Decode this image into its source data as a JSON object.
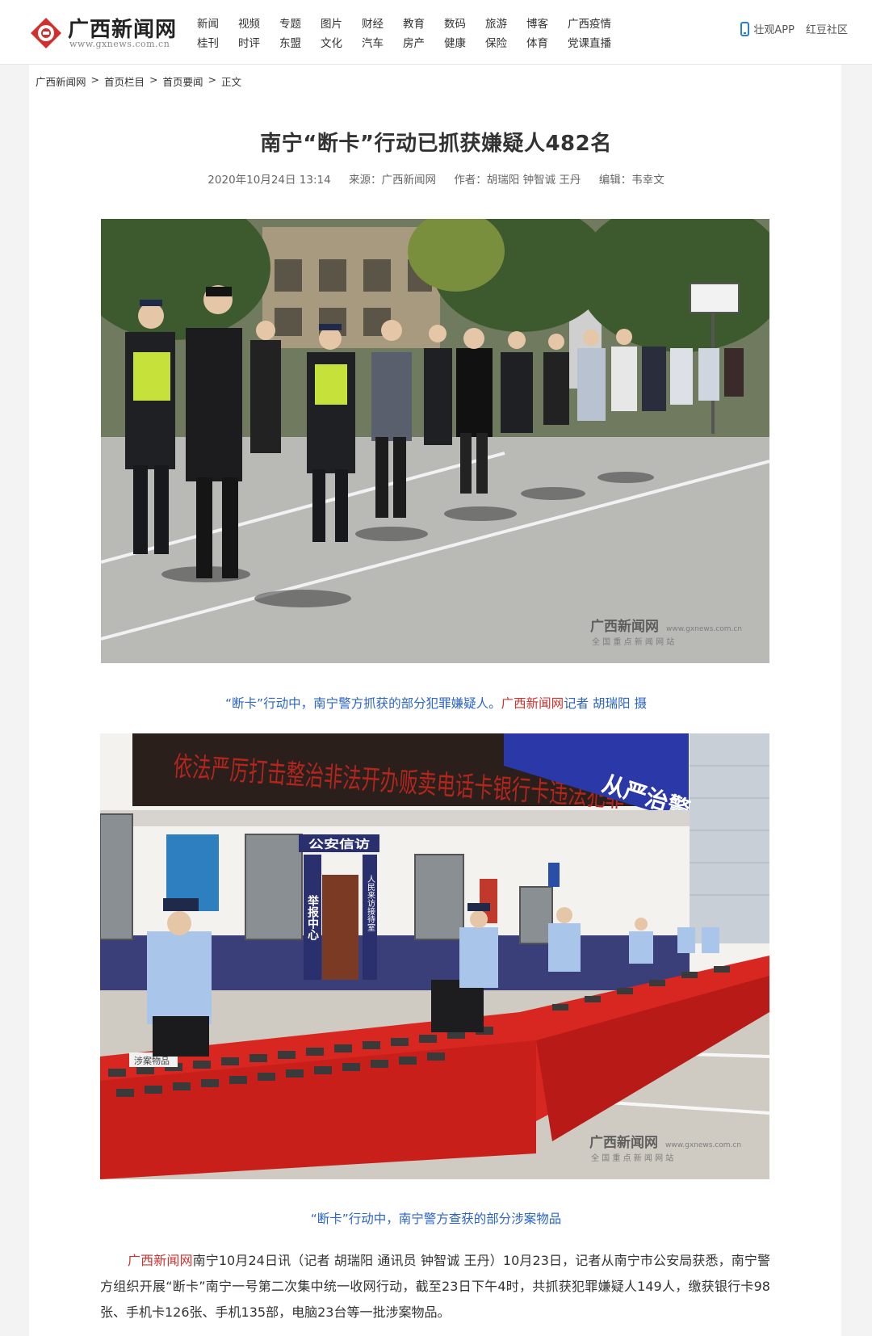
{
  "header": {
    "logo_text": "广西新闻网",
    "logo_url": "www.gxnews.com.cn",
    "nav_row1": [
      "新闻",
      "视频",
      "专题",
      "图片",
      "财经",
      "教育",
      "数码",
      "旅游",
      "博客",
      "广西疫情"
    ],
    "nav_row2": [
      "桂刊",
      "时评",
      "东盟",
      "文化",
      "汽车",
      "房产",
      "健康",
      "保险",
      "体育",
      "党课直播"
    ],
    "app_label": "壮观APP",
    "community_label": "红豆社区"
  },
  "breadcrumb": {
    "items": [
      "广西新闻网",
      "首页栏目",
      "首页要闻",
      "正文"
    ],
    "separator": ">"
  },
  "article": {
    "title": "南宁“断卡”行动已抓获嫌疑人482名",
    "date": "2020年10月24日 13:14",
    "source": "来源：广西新闻网",
    "author": "作者：胡瑞阳 钟智诚 王丹",
    "editor": "编辑：韦幸文"
  },
  "photo1": {
    "watermark": "广西新闻网",
    "watermark_sub": "全 国 重 点 新 闻 网 站",
    "watermark_url": "www.gxnews.com.cn",
    "caption_main": "“断卡”行动中，南宁警方抓获的部分犯罪嫌疑人。",
    "caption_site": "广西新闻网",
    "caption_credit": "记者 胡瑞阳 摄"
  },
  "photo2": {
    "banner_text": "依法严厉打击整治非法开办贩卖电话卡银行卡违法犯罪",
    "blue_banner": "从严治警",
    "sign1": "公安信访",
    "sign2": "举报中心",
    "sign3": "人民来访接待室",
    "table_label": "涉案物品",
    "watermark": "广西新闻网",
    "watermark_sub": "全 国 重 点 新 闻 网 站",
    "watermark_url": "www.gxnews.com.cn",
    "caption": "“断卡”行动中，南宁警方查获的部分涉案物品"
  },
  "body": {
    "site_name": "广西新闻网",
    "paragraph": "南宁10月24日讯（记者 胡瑞阳 通讯员 钟智诚 王丹）10月23日，记者从南宁市公安局获悉，南宁警方组织开展“断卡”南宁一号第二次集中统一收网行动，截至23日下午4时，共抓获犯罪嫌疑人149人，缴获银行卡98张、手机卡126张、手机135部，电脑23台等一批涉案物品。"
  },
  "colors": {
    "accent_red": "#d0312d",
    "link_blue": "#2a64c6",
    "police_blue": "#9fbde0"
  }
}
